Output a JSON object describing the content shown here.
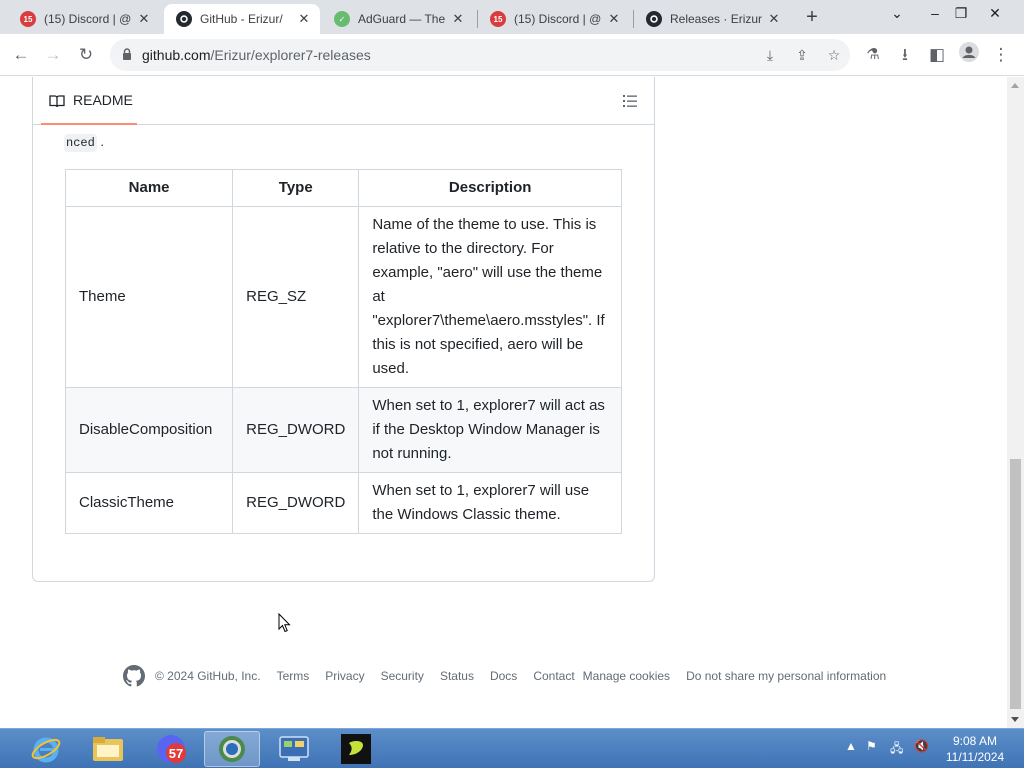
{
  "browser": {
    "tabs": [
      {
        "title": "(15) Discord | @",
        "favicon": "discord-badge-icon",
        "badge": "15"
      },
      {
        "title": "GitHub - Erizur/",
        "favicon": "github-icon",
        "active": true
      },
      {
        "title": "AdGuard — The",
        "favicon": "adguard-shield-icon"
      },
      {
        "title": "(15) Discord | @",
        "favicon": "discord-badge-icon",
        "badge": "15"
      },
      {
        "title": "Releases · Erizur",
        "favicon": "github-icon"
      }
    ],
    "new_tab": "+",
    "url_domain": "github.com",
    "url_path": "/Erizur/explorer7-releases"
  },
  "readme": {
    "title": "README",
    "partial_text": "nced",
    "partial_suffix": " .",
    "table": {
      "headers": [
        "Name",
        "Type",
        "Description"
      ],
      "rows": [
        {
          "name": "Theme",
          "type": "REG_SZ",
          "description": "Name of the theme to use. This is relative to the directory. For example, \"aero\" will use the theme at \"explorer7\\theme\\aero.msstyles\". If this is not specified, aero will be used."
        },
        {
          "name": "DisableComposition",
          "type": "REG_DWORD",
          "description": "When set to 1, explorer7 will act as if the Desktop Window Manager is not running."
        },
        {
          "name": "ClassicTheme",
          "type": "REG_DWORD",
          "description": "When set to 1, explorer7 will use the Windows Classic theme."
        }
      ]
    }
  },
  "footer": {
    "copyright": "© 2024 GitHub, Inc.",
    "links": [
      "Terms",
      "Privacy",
      "Security",
      "Status",
      "Docs",
      "Contact",
      "Manage cookies",
      "Do not share my personal information"
    ]
  },
  "taskbar": {
    "apps": [
      "internet-explorer-icon",
      "file-explorer-icon",
      "discord-icon",
      "chrome-icon",
      "control-panel-icon",
      "app-icon"
    ],
    "discord_badge": "57",
    "time": "9:08 AM",
    "date": "11/11/2024"
  },
  "colors": {
    "tabstrip": "#dee1e6",
    "link": "#636c76",
    "underline": "#fd8c73",
    "taskbar": "#4a7fc1"
  }
}
